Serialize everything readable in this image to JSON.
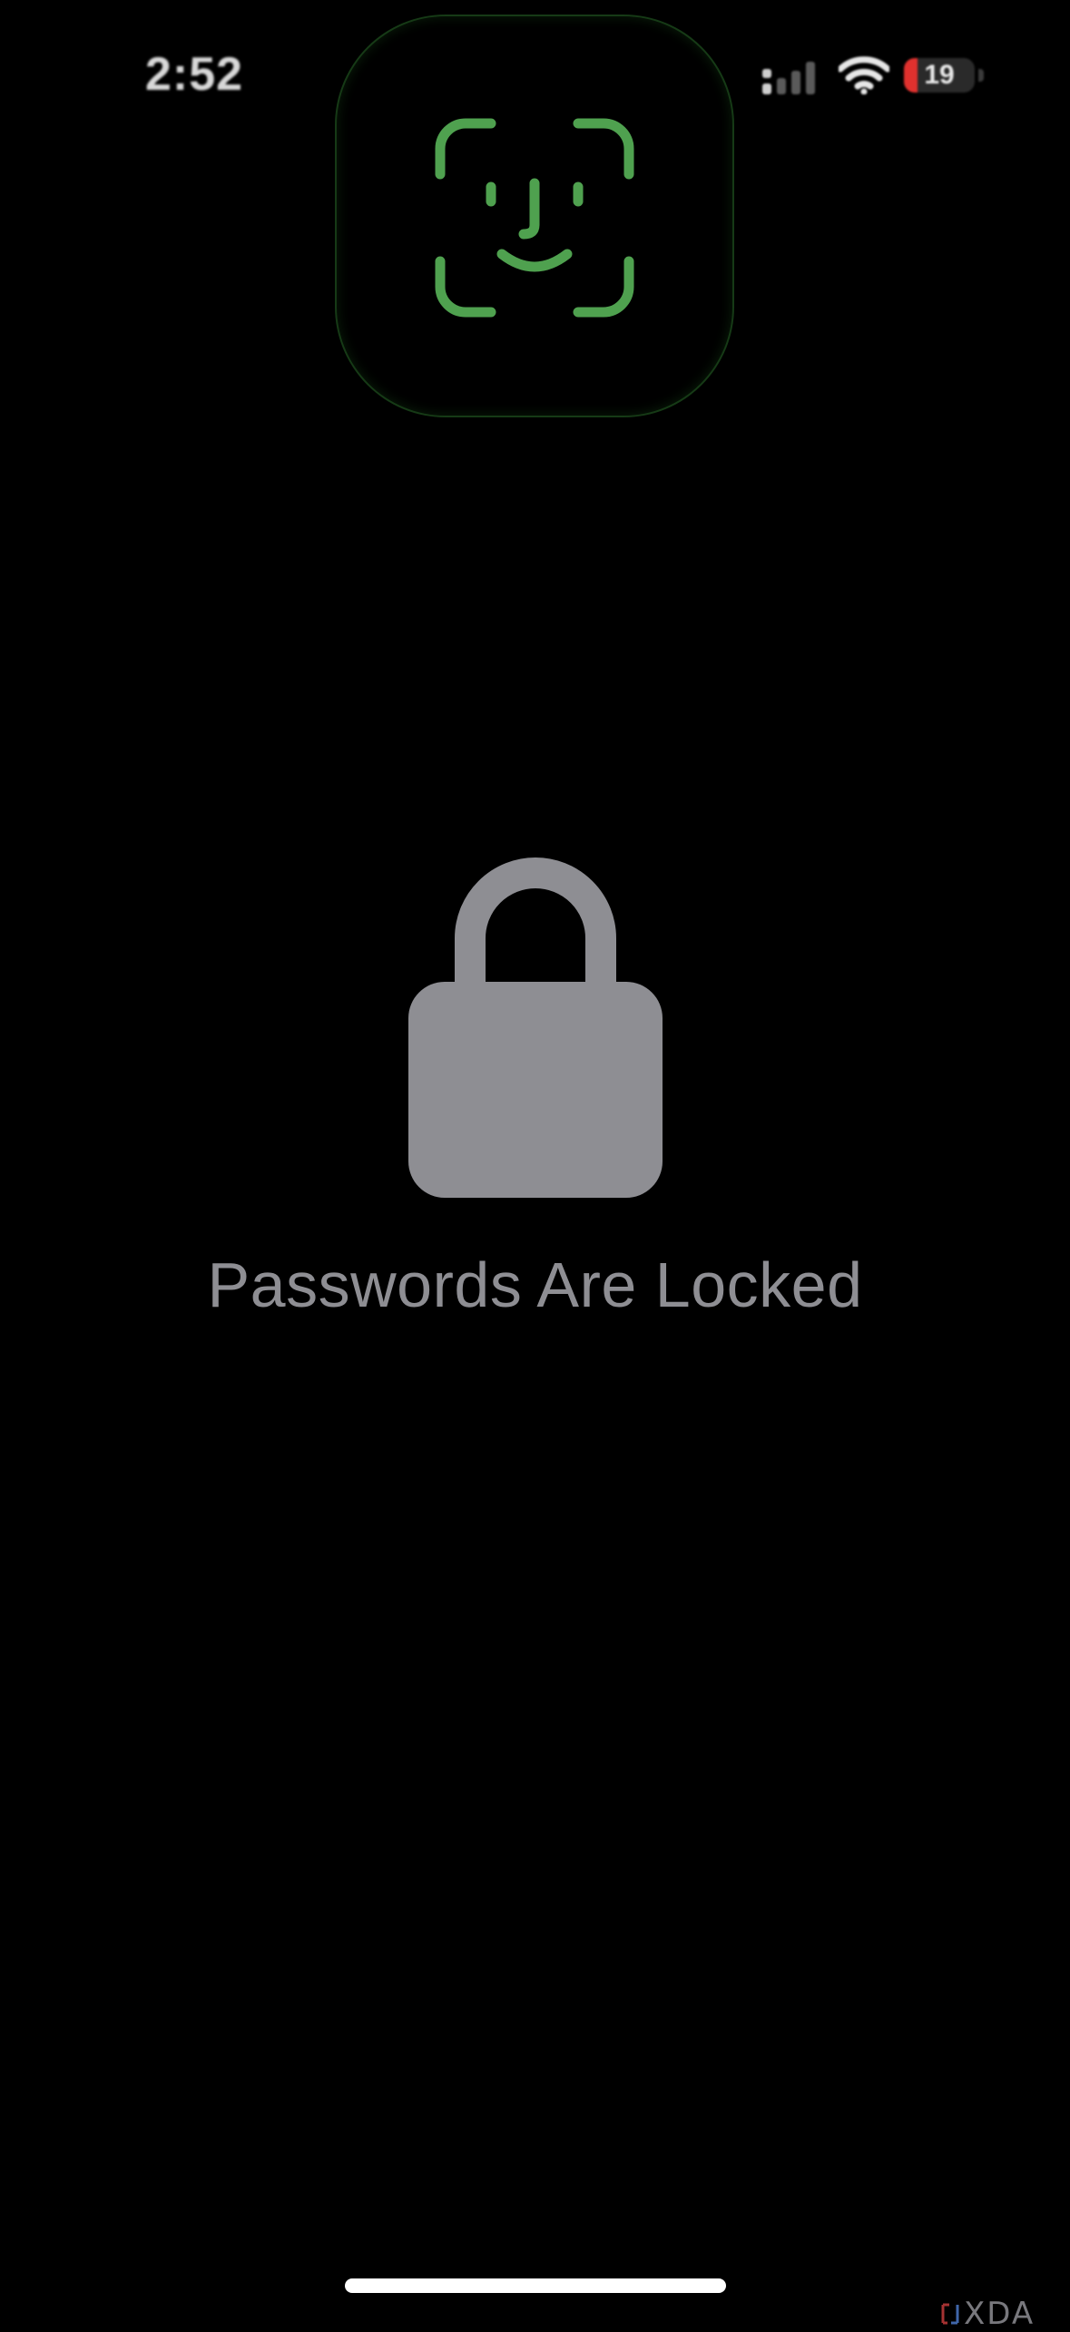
{
  "status_bar": {
    "time": "2:52",
    "signal_icon": "cellular-signal-icon",
    "wifi_icon": "wifi-icon",
    "battery_icon": "battery-icon",
    "battery_level": "19",
    "battery_fraction": 0.19,
    "battery_color": "#e0312e"
  },
  "faceid": {
    "icon": "face-id-icon",
    "color": "#4fa14f"
  },
  "main": {
    "lock_icon": "lock-icon",
    "lock_color": "#8e8e93",
    "title": "Passwords Are Locked"
  },
  "watermark": {
    "icon": "xda-logo-icon",
    "text": "XDA"
  }
}
